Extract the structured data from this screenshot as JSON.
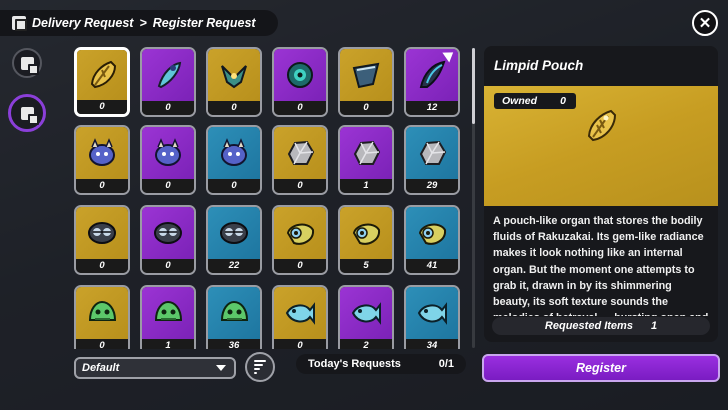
{
  "header": {
    "breadcrumb_root": "Delivery Request",
    "separator": ">",
    "breadcrumb_current": "Register Request"
  },
  "colors": {
    "gold": "#c9a12a",
    "purple": "#8b2fc9",
    "blue": "#2888b3",
    "accent": "#8b3fd9"
  },
  "grid": {
    "cards": [
      {
        "rarity": "gold",
        "icon": "leaf-pouch-icon",
        "count": "0",
        "selected": true
      },
      {
        "rarity": "purple",
        "icon": "feather-icon",
        "count": "0"
      },
      {
        "rarity": "gold",
        "icon": "bird-emblem-icon",
        "count": "0"
      },
      {
        "rarity": "purple",
        "icon": "eye-orb-icon",
        "count": "0"
      },
      {
        "rarity": "gold",
        "icon": "blade-fin-icon",
        "count": "0"
      },
      {
        "rarity": "purple",
        "icon": "horn-icon",
        "count": "12"
      },
      {
        "rarity": "gold",
        "icon": "blob-monster-icon",
        "count": "0"
      },
      {
        "rarity": "purple",
        "icon": "blob-monster-icon",
        "count": "0"
      },
      {
        "rarity": "blue",
        "icon": "blob-monster-icon",
        "count": "0"
      },
      {
        "rarity": "gold",
        "icon": "crystal-rock-icon",
        "count": "0"
      },
      {
        "rarity": "purple",
        "icon": "crystal-rock-icon",
        "count": "1"
      },
      {
        "rarity": "blue",
        "icon": "crystal-rock-icon",
        "count": "29"
      },
      {
        "rarity": "gold",
        "icon": "goggles-icon",
        "count": "0"
      },
      {
        "rarity": "purple",
        "icon": "goggles-icon",
        "count": "0"
      },
      {
        "rarity": "blue",
        "icon": "goggles-icon",
        "count": "22"
      },
      {
        "rarity": "gold",
        "icon": "shell-eye-icon",
        "count": "0"
      },
      {
        "rarity": "gold",
        "icon": "shell-eye-icon",
        "count": "5"
      },
      {
        "rarity": "blue",
        "icon": "shell-eye-icon",
        "count": "41"
      },
      {
        "rarity": "gold",
        "icon": "slime-icon",
        "count": "0"
      },
      {
        "rarity": "purple",
        "icon": "slime-icon",
        "count": "1"
      },
      {
        "rarity": "blue",
        "icon": "slime-icon",
        "count": "36"
      },
      {
        "rarity": "gold",
        "icon": "fish-icon",
        "count": "0"
      },
      {
        "rarity": "purple",
        "icon": "fish-icon",
        "count": "2"
      },
      {
        "rarity": "blue",
        "icon": "fish-icon",
        "count": "34"
      }
    ]
  },
  "controls": {
    "sort_value": "Default",
    "today_label": "Today's Requests",
    "today_value": "0/1"
  },
  "detail": {
    "item_name": "Limpid Pouch",
    "owned_label": "Owned",
    "owned_value": "0",
    "description": "A pouch-like organ that stores the bodily fluids of Rakuzakai. Its gem-like radiance makes it look nothing like an internal organ. But the moment one attempts to grab it, drawn in by its shimmering beauty, its soft texture sounds the melodies of betrayal — bursting open and spraying black liquid everywhere. It's the demise of",
    "requested_label": "Requested Items",
    "requested_value": "1"
  },
  "register_label": "Register"
}
